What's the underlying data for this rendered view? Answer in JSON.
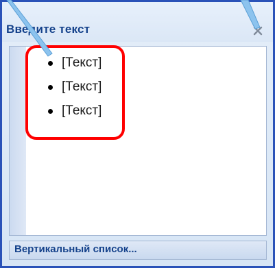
{
  "pane": {
    "title": "Введите текст",
    "close_icon": "close-icon"
  },
  "editor": {
    "items": [
      {
        "text": "[Текст]"
      },
      {
        "text": "[Текст]"
      },
      {
        "text": "[Текст]"
      }
    ]
  },
  "footer": {
    "link_label": "Вертикальный список..."
  },
  "colors": {
    "frame": "#2a52b8",
    "title": "#15428b",
    "highlight": "#ff0000",
    "callout": "#7ab6e8"
  }
}
